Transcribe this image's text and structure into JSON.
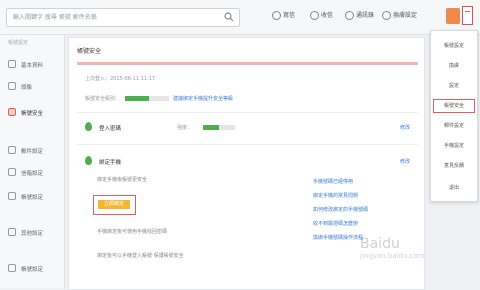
{
  "search": {
    "placeholder": "輸入關鍵字 搜尋 帳號 郵件名稱"
  },
  "toolbar": {
    "items": [
      {
        "label": "寫信",
        "icon": "compose-icon"
      },
      {
        "label": "收信",
        "icon": "inbox-icon"
      },
      {
        "label": "通訊錄",
        "icon": "contacts-icon"
      },
      {
        "label": "換膚設定",
        "icon": "skin-icon"
      }
    ]
  },
  "sidebar": {
    "heading": "帳號設定",
    "items": [
      {
        "label": "基本資料",
        "active": false
      },
      {
        "label": "頭像",
        "active": false
      },
      {
        "label": "帳號安全",
        "active": true
      },
      {
        "label": "郵件設定",
        "active": false
      },
      {
        "label": "信箱設定",
        "active": false
      },
      {
        "label": "帳號設定",
        "active": false
      },
      {
        "label": "其他設定",
        "active": false
      },
      {
        "label": "帳號設定",
        "active": false
      }
    ]
  },
  "panel": {
    "title": "帳號安全",
    "info_line1": "上次登入：2015-06-11 11:17",
    "info_line2": "帳號安全級別：",
    "info_line2_link": "建議綁定手機提升安全等級",
    "security_progress": 0.55,
    "row_password": {
      "name": "登入密碼",
      "status": "強度：",
      "edit": "修改",
      "strength": 0.5
    },
    "row_phone": {
      "name": "綁定手機",
      "edit": "修改",
      "desc": "綁定手機後帳號更安全",
      "button": "立即綁定",
      "hint1": "手機綁定後可使用手機找回密碼",
      "hint2": "綁定後可以手機登入帳號 保護帳號安全"
    },
    "links": [
      "手機號碼已經停用",
      "綁定手機的常見問題",
      "如何修改綁定的手機號碼",
      "收不到驗證碼怎麼辦",
      "換綁手機號碼操作流程"
    ]
  },
  "dropdown": {
    "items": [
      {
        "label": "帳號設定",
        "highlight": false
      },
      {
        "label": "換膚",
        "highlight": false
      },
      {
        "label": "設定",
        "highlight": false
      },
      {
        "label": "帳號安全",
        "highlight": true
      },
      {
        "label": "郵件設定",
        "highlight": false
      },
      {
        "label": "手機設定",
        "highlight": false
      },
      {
        "label": "意見反饋",
        "highlight": false
      },
      {
        "label": "退出",
        "highlight": false
      }
    ]
  },
  "watermark": {
    "main": "Baidu",
    "sub": "jingyan.baidu.com"
  }
}
